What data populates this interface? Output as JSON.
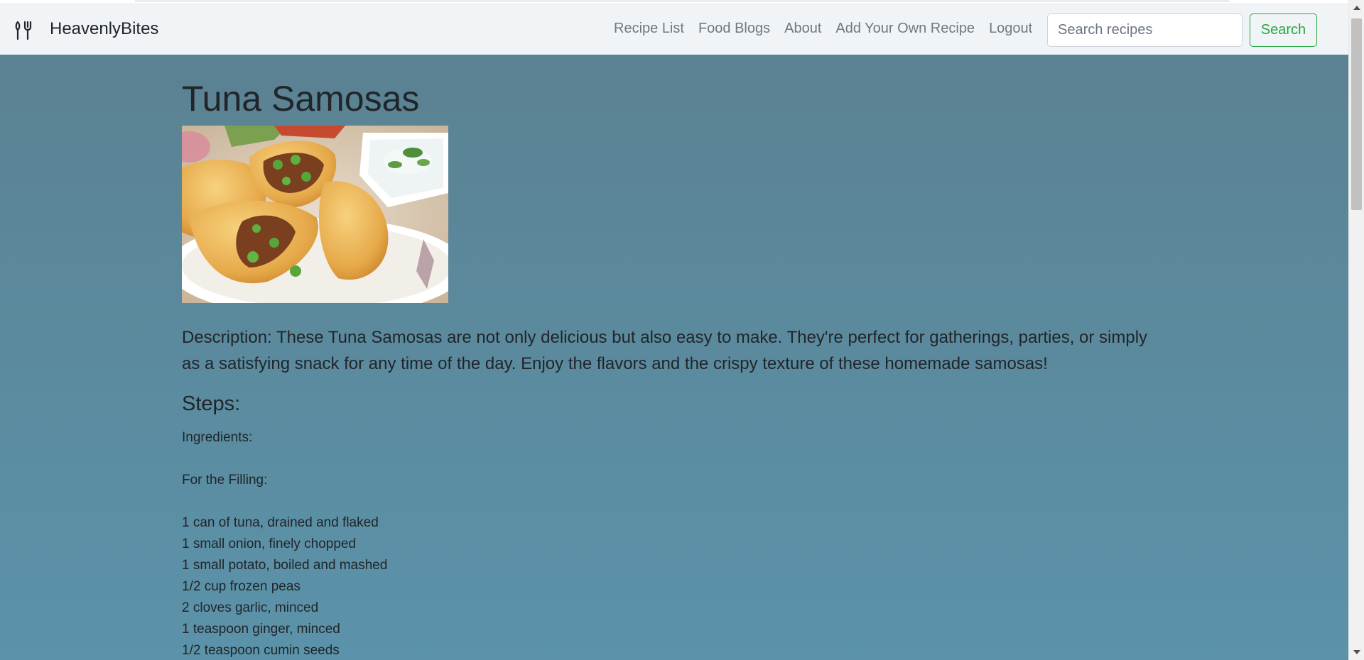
{
  "navbar": {
    "brand": "HeavenlyBites",
    "links": [
      "Recipe List",
      "Food Blogs",
      "About",
      "Add Your Own Recipe",
      "Logout"
    ],
    "search_placeholder": "Search recipes",
    "search_button": "Search"
  },
  "recipe": {
    "title": "Tuna Samosas",
    "description": "Description: These Tuna Samosas are not only delicious but also easy to make. They're perfect for gatherings, parties, or simply as a satisfying snack for any time of the day. Enjoy the flavors and the crispy texture of these homemade samosas!",
    "steps_heading": "Steps:",
    "steps_lines": [
      "Ingredients:",
      "",
      "For the Filling:",
      "",
      "1 can of tuna, drained and flaked",
      "1 small onion, finely chopped",
      "1 small potato, boiled and mashed",
      "1/2 cup frozen peas",
      "2 cloves garlic, minced",
      "1 teaspoon ginger, minced",
      "1/2 teaspoon cumin seeds"
    ]
  },
  "colors": {
    "accent": "#28a745",
    "navbar_bg": "#f0f4f7",
    "page_bg": "#5b93aa"
  },
  "icons": {
    "brand": "fork-knife-icon"
  }
}
